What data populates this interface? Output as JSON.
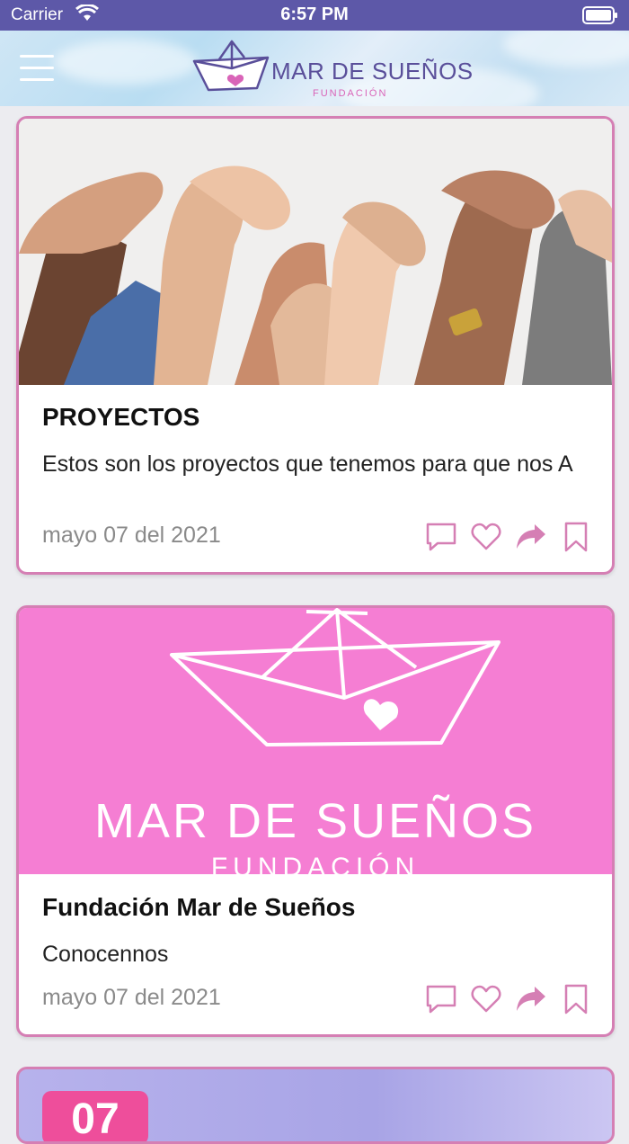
{
  "status_bar": {
    "carrier": "Carrier",
    "time": "6:57 PM"
  },
  "header": {
    "logo_title": "MAR DE SUEÑOS",
    "logo_subtitle": "FUNDACIÓN"
  },
  "cards": [
    {
      "image_alt": "raised joined hands",
      "title": "PROYECTOS",
      "text": "Estos son los proyectos que tenemos para que nos A",
      "date": "mayo 07 del 2021"
    },
    {
      "image_alt": "Mar de Sueños paper boat logo",
      "image_title": "MAR DE SUEÑOS",
      "image_subtitle": "FUNDACIÓN",
      "title": "Fundación Mar de Sueños",
      "text": "Conocennos",
      "date": "mayo 07 del 2021"
    }
  ],
  "card3": {
    "badge": "07"
  },
  "icons": {
    "comment": "comment-icon",
    "like": "heart-icon",
    "share": "share-icon",
    "bookmark": "bookmark-icon"
  },
  "colors": {
    "accent_pink": "#d57fb4",
    "status_bar": "#5d58a8",
    "brand_purple": "#5a4f9a",
    "brand_pink_bg": "#f57ed3"
  }
}
